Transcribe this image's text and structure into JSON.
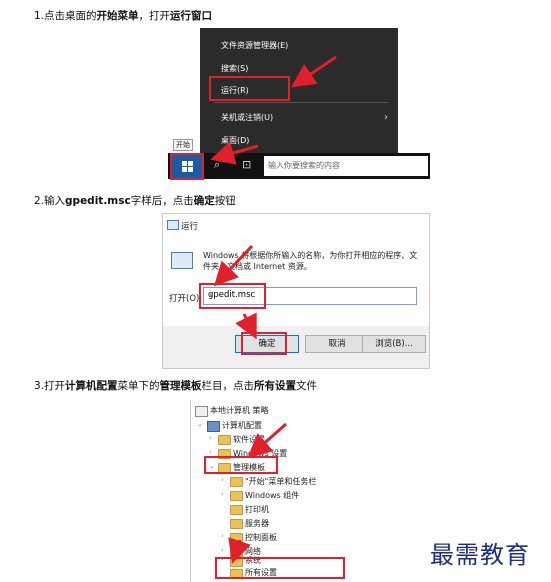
{
  "steps": {
    "s1": {
      "pre": "1.点击桌面的",
      "b1": "开始菜单",
      "mid": "，打开",
      "b2": "运行窗口",
      "post": ""
    },
    "s2": {
      "pre": "2.输入",
      "b1": "gpedit.msc",
      "mid": "字样后，点击",
      "b2": "确定",
      "post": "按钮"
    },
    "s3": {
      "pre": "3.打开",
      "b1": "计算机配置",
      "mid": "菜单下的",
      "b2": "管理模板",
      "post": "栏目，点击",
      "b3": "所有设置",
      "post2": "文件"
    }
  },
  "context_menu": {
    "items": [
      "文件资源管理器(E)",
      "搜索(S)",
      "运行(R)",
      "关机或注销(U)",
      "桌面(D)"
    ],
    "chevron": "›"
  },
  "taskbar": {
    "tooltip": "开始",
    "search_placeholder": "输入你要搜索的内容",
    "search_icon": "⌕",
    "taskview_icon": "⊡"
  },
  "run_dialog": {
    "title": "运行",
    "description": "Windows 将根据你所输入的名称，为你打开相应的程序、文件夹、文档或 Internet 资源。",
    "open_label": "打开(O):",
    "input_value": "gpedit.msc",
    "dropdown_icon": "⌄",
    "buttons": {
      "ok": "确定",
      "cancel": "取消",
      "browse": "浏览(B)..."
    }
  },
  "tree": {
    "root": "本地计算机 策略",
    "computer_config": "计算机配置",
    "software_settings": "软件设置",
    "windows_settings": "Windows 设置",
    "admin_templates": "管理模板",
    "children": [
      "\"开始\"菜单和任务栏",
      "Windows 组件",
      "打印机",
      "服务器",
      "控制面板",
      "网络",
      "系统",
      "所有设置"
    ]
  },
  "watermark": "最需教育",
  "colors": {
    "highlight": "#e0202a",
    "start_button": "#1c5aa6",
    "menu_bg": "#2b2b2b",
    "watermark": "#1b2f86"
  }
}
